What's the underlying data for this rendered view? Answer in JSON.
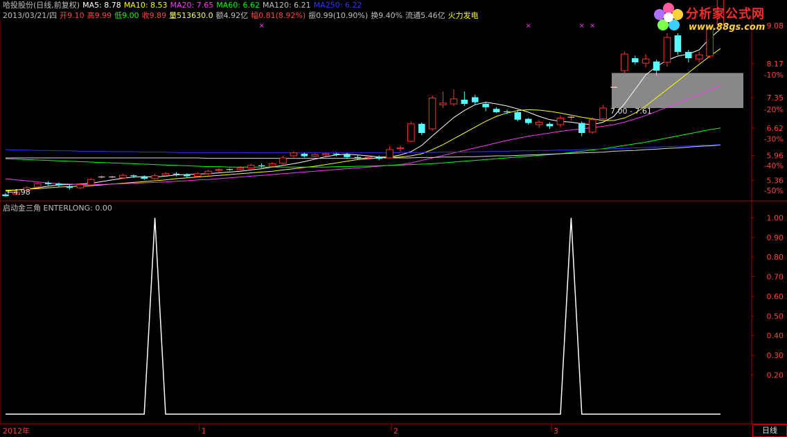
{
  "header": {
    "stock": "哈投股份(日线,前复权)",
    "ma": [
      {
        "label": "MA5: 8.78",
        "color": "#ffffff"
      },
      {
        "label": "MA10: 8.53",
        "color": "#ffff00"
      },
      {
        "label": "MA20: 7.65",
        "color": "#ff33ff"
      },
      {
        "label": "MA60: 6.62",
        "color": "#00ff00"
      },
      {
        "label": "MA120: 6.21",
        "color": "#c0c0c0"
      },
      {
        "label": "MA250: 6.22",
        "color": "#3333ff"
      }
    ],
    "quote": [
      {
        "text": "2013/03/21/四",
        "color": "#c0c0c0"
      },
      {
        "text": "开9.10",
        "color": "#ff4444"
      },
      {
        "text": "高9.99",
        "color": "#ff4444"
      },
      {
        "text": "低9.00",
        "color": "#00ff00"
      },
      {
        "text": "收9.89",
        "color": "#ff4444"
      },
      {
        "text": "量513630.0",
        "color": "#ffff66"
      },
      {
        "text": "额4.92亿",
        "color": "#c0c0c0"
      },
      {
        "text": "幅0.81(8.92%)",
        "color": "#ff4444"
      },
      {
        "text": "振0.99(10.90%)",
        "color": "#c0c0c0"
      },
      {
        "text": "换9.40%",
        "color": "#c0c0c0"
      },
      {
        "text": "流通5.46亿",
        "color": "#c0c0c0"
      },
      {
        "text": "火力发电",
        "color": "#ffff00"
      }
    ]
  },
  "watermark": {
    "text": "分析家公式网",
    "url": "www.88gs.com"
  },
  "indicator_title": "启动金三角  ENTERLONG: 0.00",
  "period_tab": "日线",
  "chart_data": [
    {
      "type": "candlestick",
      "title": "",
      "y_ticks": [
        "9.08",
        "8.17",
        "7.35",
        "6.62",
        "5.96",
        "5.36"
      ],
      "y_tick_values": [
        9.08,
        8.17,
        7.35,
        6.62,
        5.96,
        5.36
      ],
      "pct_ticks": [
        "-10%",
        "-20%",
        "-30%",
        "-40%",
        "-50%"
      ],
      "pct_tick_values": [
        7.9,
        7.07,
        6.36,
        5.72,
        5.12
      ],
      "ylim": [
        4.9,
        9.2
      ],
      "x_ticks": [
        "2012年",
        "1",
        "2",
        "3"
      ],
      "x_tick_index": [
        0,
        19,
        37,
        52
      ],
      "annotations": [
        {
          "text": "←4.98",
          "index": 0,
          "value": 4.98
        },
        {
          "text": "7.00 - 7.61",
          "index": 57,
          "value": 6.9
        }
      ],
      "highlight_band": [
        7.0,
        7.61
      ],
      "candles": [
        [
          5.02,
          4.98,
          5.06,
          4.96
        ],
        [
          5.02,
          5.08,
          5.12,
          5.0
        ],
        [
          5.12,
          5.18,
          5.22,
          5.1
        ],
        [
          5.2,
          5.28,
          5.32,
          5.18
        ],
        [
          5.3,
          5.27,
          5.34,
          5.24
        ],
        [
          5.28,
          5.24,
          5.31,
          5.2
        ],
        [
          5.22,
          5.18,
          5.26,
          5.14
        ],
        [
          5.18,
          5.26,
          5.3,
          5.15
        ],
        [
          5.25,
          5.38,
          5.42,
          5.22
        ],
        [
          5.44,
          5.44,
          5.48,
          5.4
        ],
        [
          5.44,
          5.44,
          5.47,
          5.4
        ],
        [
          5.42,
          5.48,
          5.52,
          5.4
        ],
        [
          5.48,
          5.46,
          5.5,
          5.42
        ],
        [
          5.45,
          5.4,
          5.48,
          5.37
        ],
        [
          5.4,
          5.47,
          5.52,
          5.38
        ],
        [
          5.48,
          5.52,
          5.56,
          5.44
        ],
        [
          5.52,
          5.5,
          5.56,
          5.46
        ],
        [
          5.5,
          5.46,
          5.53,
          5.43
        ],
        [
          5.46,
          5.52,
          5.56,
          5.44
        ],
        [
          5.52,
          5.58,
          5.62,
          5.48
        ],
        [
          5.6,
          5.62,
          5.66,
          5.56
        ],
        [
          5.62,
          5.62,
          5.66,
          5.58
        ],
        [
          5.62,
          5.66,
          5.7,
          5.6
        ],
        [
          5.66,
          5.72,
          5.76,
          5.64
        ],
        [
          5.72,
          5.7,
          5.77,
          5.66
        ],
        [
          5.7,
          5.76,
          5.8,
          5.67
        ],
        [
          5.77,
          5.9,
          5.95,
          5.75
        ],
        [
          5.95,
          6.02,
          6.06,
          5.92
        ],
        [
          6.0,
          5.94,
          6.03,
          5.91
        ],
        [
          5.94,
          5.98,
          6.01,
          5.92
        ],
        [
          5.97,
          6.0,
          6.03,
          5.93
        ],
        [
          6.0,
          5.98,
          6.02,
          5.94
        ],
        [
          5.98,
          5.92,
          6.02,
          5.88
        ],
        [
          5.92,
          5.9,
          5.96,
          5.86
        ],
        [
          5.9,
          5.92,
          5.95,
          5.86
        ],
        [
          5.92,
          5.88,
          5.96,
          5.84
        ],
        [
          5.9,
          6.1,
          6.18,
          5.88
        ],
        [
          6.12,
          6.14,
          6.2,
          6.05
        ],
        [
          6.3,
          6.72,
          6.78,
          6.28
        ],
        [
          6.72,
          6.5,
          6.75,
          6.45
        ],
        [
          6.6,
          7.34,
          7.4,
          6.55
        ],
        [
          7.18,
          7.22,
          7.5,
          7.1
        ],
        [
          7.2,
          7.32,
          7.55,
          7.15
        ],
        [
          7.3,
          7.2,
          7.5,
          7.15
        ],
        [
          7.36,
          7.24,
          7.42,
          7.18
        ],
        [
          7.2,
          7.12,
          7.25,
          7.02
        ],
        [
          7.08,
          7.0,
          7.12,
          6.98
        ],
        [
          7.02,
          7.0,
          7.06,
          6.95
        ],
        [
          7.0,
          6.82,
          7.06,
          6.78
        ],
        [
          6.84,
          6.74,
          6.86,
          6.7
        ],
        [
          6.7,
          6.76,
          6.8,
          6.62
        ],
        [
          6.72,
          6.66,
          6.76,
          6.6
        ],
        [
          6.7,
          6.86,
          6.92,
          6.64
        ],
        [
          6.88,
          6.88,
          6.94,
          6.8
        ],
        [
          6.74,
          6.5,
          6.78,
          6.42
        ],
        [
          6.52,
          6.82,
          6.88,
          6.48
        ],
        [
          6.84,
          7.1,
          7.18,
          6.8
        ],
        [
          7.6,
          7.6,
          7.63,
          7.56
        ],
        [
          8.0,
          8.4,
          8.46,
          7.94
        ],
        [
          8.3,
          8.2,
          8.36,
          8.15
        ],
        [
          8.18,
          8.28,
          8.4,
          8.08
        ],
        [
          8.22,
          8.0,
          8.26,
          7.88
        ],
        [
          8.2,
          8.8,
          8.9,
          8.1
        ],
        [
          8.85,
          8.45,
          8.9,
          8.38
        ],
        [
          8.45,
          8.3,
          8.5,
          8.2
        ],
        [
          8.28,
          8.38,
          8.45,
          8.2
        ],
        [
          8.35,
          9.05,
          9.1,
          8.3
        ],
        [
          9.1,
          9.89,
          9.99,
          9.0
        ]
      ],
      "ma_series": [
        {
          "name": "MA5",
          "color": "#ffffff",
          "values": [
            5.1,
            5.13,
            5.15,
            5.18,
            5.22,
            5.25,
            5.26,
            5.27,
            5.29,
            5.33,
            5.37,
            5.41,
            5.44,
            5.45,
            5.44,
            5.46,
            5.49,
            5.5,
            5.51,
            5.52,
            5.54,
            5.56,
            5.58,
            5.61,
            5.64,
            5.68,
            5.72,
            5.76,
            5.81,
            5.87,
            5.93,
            5.97,
            5.99,
            5.97,
            5.95,
            5.92,
            5.92,
            5.97,
            6.05,
            6.2,
            6.43,
            6.65,
            6.87,
            7.04,
            7.18,
            7.24,
            7.2,
            7.15,
            7.08,
            7.0,
            6.9,
            6.82,
            6.78,
            6.76,
            6.72,
            6.7,
            6.76,
            6.9,
            7.2,
            7.55,
            7.9,
            8.1,
            8.25,
            8.35,
            8.4,
            8.5,
            8.78,
            9.0
          ]
        },
        {
          "name": "MA10",
          "color": "#ffff00",
          "values": [
            5.12,
            5.13,
            5.15,
            5.16,
            5.18,
            5.2,
            5.21,
            5.22,
            5.23,
            5.25,
            5.27,
            5.29,
            5.31,
            5.33,
            5.35,
            5.37,
            5.4,
            5.42,
            5.44,
            5.46,
            5.48,
            5.5,
            5.52,
            5.54,
            5.56,
            5.58,
            5.61,
            5.64,
            5.67,
            5.7,
            5.74,
            5.78,
            5.82,
            5.86,
            5.88,
            5.9,
            5.91,
            5.92,
            5.95,
            6.0,
            6.1,
            6.22,
            6.36,
            6.5,
            6.64,
            6.78,
            6.9,
            6.98,
            7.04,
            7.06,
            7.05,
            7.02,
            6.98,
            6.93,
            6.88,
            6.84,
            6.8,
            6.8,
            6.86,
            6.98,
            7.15,
            7.35,
            7.55,
            7.75,
            7.95,
            8.15,
            8.35,
            8.53
          ]
        },
        {
          "name": "MA20",
          "color": "#ff33ff",
          "values": [
            5.4,
            5.37,
            5.35,
            5.32,
            5.3,
            5.28,
            5.27,
            5.26,
            5.26,
            5.26,
            5.27,
            5.28,
            5.29,
            5.3,
            5.31,
            5.32,
            5.34,
            5.35,
            5.37,
            5.38,
            5.4,
            5.42,
            5.44,
            5.46,
            5.48,
            5.5,
            5.52,
            5.54,
            5.56,
            5.58,
            5.6,
            5.62,
            5.64,
            5.66,
            5.68,
            5.7,
            5.72,
            5.74,
            5.78,
            5.84,
            5.9,
            5.96,
            6.02,
            6.08,
            6.14,
            6.2,
            6.26,
            6.32,
            6.37,
            6.42,
            6.46,
            6.5,
            6.54,
            6.57,
            6.6,
            6.63,
            6.66,
            6.7,
            6.76,
            6.84,
            6.92,
            7.02,
            7.12,
            7.22,
            7.32,
            7.42,
            7.53,
            7.65
          ]
        },
        {
          "name": "MA60",
          "color": "#00ff00",
          "values": [
            5.88,
            5.87,
            5.86,
            5.85,
            5.84,
            5.83,
            5.82,
            5.81,
            5.8,
            5.79,
            5.78,
            5.77,
            5.76,
            5.75,
            5.74,
            5.73,
            5.72,
            5.71,
            5.7,
            5.69,
            5.69,
            5.68,
            5.68,
            5.68,
            5.68,
            5.68,
            5.68,
            5.68,
            5.68,
            5.68,
            5.68,
            5.69,
            5.69,
            5.7,
            5.7,
            5.71,
            5.72,
            5.73,
            5.74,
            5.75,
            5.76,
            5.78,
            5.8,
            5.82,
            5.84,
            5.86,
            5.88,
            5.9,
            5.92,
            5.94,
            5.96,
            5.98,
            6.0,
            6.03,
            6.06,
            6.09,
            6.12,
            6.16,
            6.2,
            6.24,
            6.28,
            6.33,
            6.38,
            6.43,
            6.48,
            6.53,
            6.58,
            6.62
          ]
        },
        {
          "name": "MA120",
          "color": "#d8d8d8",
          "values": [
            5.9,
            5.9,
            5.9,
            5.9,
            5.9,
            5.9,
            5.9,
            5.9,
            5.9,
            5.9,
            5.9,
            5.9,
            5.9,
            5.9,
            5.9,
            5.9,
            5.9,
            5.9,
            5.9,
            5.89,
            5.89,
            5.89,
            5.89,
            5.89,
            5.89,
            5.89,
            5.89,
            5.89,
            5.89,
            5.89,
            5.89,
            5.89,
            5.89,
            5.89,
            5.89,
            5.9,
            5.9,
            5.9,
            5.9,
            5.91,
            5.91,
            5.92,
            5.92,
            5.93,
            5.93,
            5.94,
            5.95,
            5.95,
            5.96,
            5.97,
            5.98,
            5.99,
            6.0,
            6.01,
            6.02,
            6.03,
            6.04,
            6.06,
            6.07,
            6.08,
            6.1,
            6.11,
            6.13,
            6.14,
            6.16,
            6.18,
            6.19,
            6.21
          ]
        },
        {
          "name": "MA250",
          "color": "#3333ff",
          "values": [
            6.1,
            6.09,
            6.09,
            6.08,
            6.08,
            6.07,
            6.07,
            6.06,
            6.06,
            6.06,
            6.05,
            6.05,
            6.05,
            6.04,
            6.04,
            6.04,
            6.03,
            6.03,
            6.03,
            6.03,
            6.03,
            6.03,
            6.03,
            6.02,
            6.02,
            6.02,
            6.02,
            6.02,
            6.02,
            6.02,
            6.02,
            6.02,
            6.02,
            6.02,
            6.02,
            6.02,
            6.02,
            6.03,
            6.03,
            6.03,
            6.03,
            6.04,
            6.04,
            6.04,
            6.05,
            6.05,
            6.06,
            6.06,
            6.07,
            6.07,
            6.08,
            6.08,
            6.09,
            6.09,
            6.1,
            6.11,
            6.11,
            6.12,
            6.13,
            6.14,
            6.15,
            6.16,
            6.17,
            6.18,
            6.19,
            6.2,
            6.21,
            6.22
          ]
        }
      ],
      "markers": [
        {
          "symbol": "×",
          "index": 24
        },
        {
          "symbol": "×",
          "index": 49
        },
        {
          "symbol": "×",
          "index": 54
        },
        {
          "symbol": "×",
          "index": 55
        }
      ]
    },
    {
      "type": "line",
      "title": "",
      "y_ticks": [
        "1.00",
        "0.90",
        "0.80",
        "0.70",
        "0.60",
        "0.50",
        "0.40",
        "0.30",
        "0.20"
      ],
      "y_tick_values": [
        1.0,
        0.9,
        0.8,
        0.7,
        0.6,
        0.5,
        0.4,
        0.3,
        0.2
      ],
      "ylim": [
        0.0,
        1.03
      ],
      "series": [
        {
          "color": "#ffffff",
          "values": [
            0,
            0,
            0,
            0,
            0,
            0,
            0,
            0,
            0,
            0,
            0,
            0,
            0,
            0,
            1,
            0,
            0,
            0,
            0,
            0,
            0,
            0,
            0,
            0,
            0,
            0,
            0,
            0,
            0,
            0,
            0,
            0,
            0,
            0,
            0,
            0,
            0,
            0,
            0,
            0,
            0,
            0,
            0,
            0,
            0,
            0,
            0,
            0,
            0,
            0,
            0,
            0,
            0,
            1,
            0,
            0,
            0,
            0,
            0,
            0,
            0,
            0,
            0,
            0,
            0,
            0,
            0,
            0
          ]
        }
      ]
    }
  ]
}
